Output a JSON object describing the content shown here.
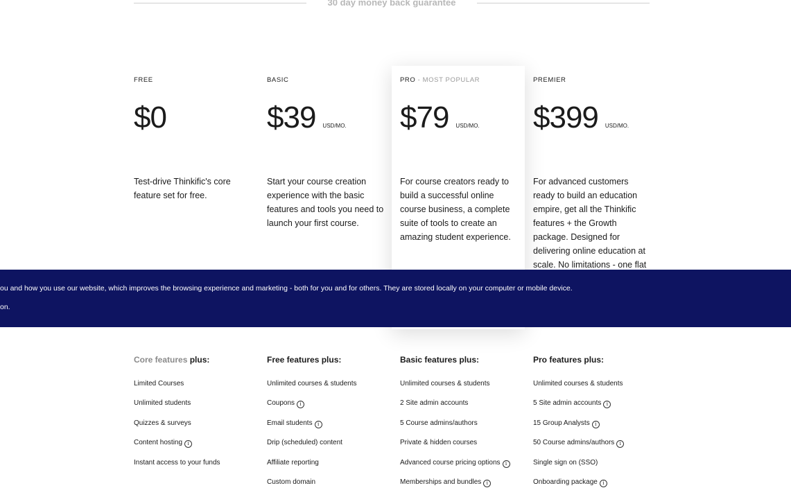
{
  "guarantee": {
    "text": "30 day money back guarantee"
  },
  "plans": [
    {
      "name": "FREE",
      "tag": "",
      "price": "$0",
      "unit": "",
      "description": "Test-drive Thinkific's core feature set for free."
    },
    {
      "name": "BASIC",
      "tag": "",
      "price": "$39",
      "unit": "USD/MO.",
      "description": "Start your course creation experience with the basic features and tools you need to launch your first course."
    },
    {
      "name": "PRO",
      "tag": " - MOST POPULAR",
      "price": "$79",
      "unit": "USD/MO.",
      "description": "For course creators ready to build a successful online course business, a complete suite of tools to create an amazing student experience."
    },
    {
      "name": "PREMIER",
      "tag": "",
      "price": "$399",
      "unit": "USD/MO.",
      "description": "For advanced customers ready to build an education empire, get all the Thinkific features + the Growth package. Designed for delivering online education at scale. No limitations - one flat fee."
    }
  ],
  "cookie_banner": {
    "line1": "ou and how you use our website, which improves the browsing experience and marketing - both for you and for others. They are stored locally on your computer or mobile device.",
    "line2": "on.",
    "background": "#0e1461"
  },
  "features": [
    {
      "heading_muted": "Core features",
      "heading": " plus:",
      "items": [
        {
          "label": "Limited Courses",
          "info": false
        },
        {
          "label": "Unlimited students",
          "info": false
        },
        {
          "label": "Quizzes & surveys",
          "info": false
        },
        {
          "label": "Content hosting",
          "info": true
        },
        {
          "label": "Instant access to your funds",
          "info": false
        }
      ]
    },
    {
      "heading_muted": "",
      "heading": "Free features plus:",
      "items": [
        {
          "label": "Unlimited courses & students",
          "info": false
        },
        {
          "label": "Coupons",
          "info": true
        },
        {
          "label": "Email students",
          "info": true
        },
        {
          "label": "Drip (scheduled) content",
          "info": false
        },
        {
          "label": "Affiliate reporting",
          "info": false
        },
        {
          "label": "Custom domain",
          "info": false
        }
      ]
    },
    {
      "heading_muted": "",
      "heading": "Basic features plus:",
      "items": [
        {
          "label": "Unlimited courses & students",
          "info": false
        },
        {
          "label": "2 Site admin accounts",
          "info": false
        },
        {
          "label": "5 Course admins/authors",
          "info": false
        },
        {
          "label": "Private & hidden courses",
          "info": false
        },
        {
          "label": "Advanced course pricing options",
          "info": true
        },
        {
          "label": "Memberships and bundles",
          "info": true
        }
      ]
    },
    {
      "heading_muted": "",
      "heading": "Pro features plus:",
      "items": [
        {
          "label": "Unlimited courses & students",
          "info": false
        },
        {
          "label": "5 Site admin accounts",
          "info": true
        },
        {
          "label": "15 Group Analysts",
          "info": true
        },
        {
          "label": "50 Course admins/authors",
          "info": true
        },
        {
          "label": "Single sign on (SSO)",
          "info": false
        },
        {
          "label": "Onboarding package",
          "info": true
        }
      ]
    }
  ],
  "icons": {
    "info": "info-icon",
    "info_glyph": "i"
  }
}
